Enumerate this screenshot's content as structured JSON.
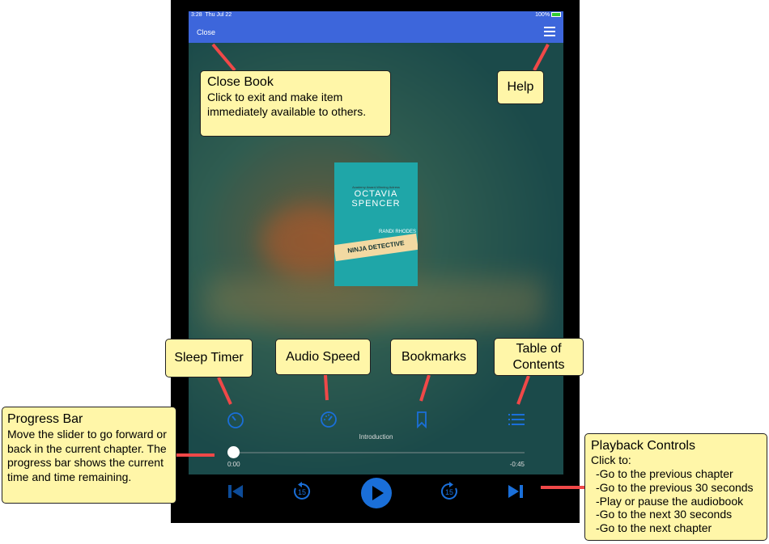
{
  "status": {
    "time": "3:28",
    "date": "Thu Jul 22",
    "battery": "100%"
  },
  "nav": {
    "close": "Close",
    "menu_icon": "hamburger-menu-icon"
  },
  "book": {
    "cover_tagline": "Academy Award-Winning Actress",
    "cover_author": "OCTAVIA SPENCER",
    "cover_series": "RANDI RHODES",
    "cover_title": "NINJA DETECTIVE"
  },
  "player": {
    "chapter": "Introduction",
    "elapsed": "0:00",
    "remaining": "-0:45",
    "progress": 0,
    "skip_seconds": "15",
    "accent": "#1a6fd9"
  },
  "callouts": {
    "close": {
      "title": "Close Book",
      "text": "Click to exit and make item immediately available to others."
    },
    "help": {
      "title": "Help"
    },
    "sleep": {
      "title": "Sleep Timer"
    },
    "speed": {
      "title": "Audio Speed"
    },
    "bookmarks": {
      "title": "Bookmarks"
    },
    "toc": {
      "title": "Table of Contents"
    },
    "progress": {
      "title": "Progress Bar",
      "text": "Move the slider to go forward or back in the current chapter. The progress bar shows the current time and time remaining."
    },
    "playback": {
      "title": "Playback Controls",
      "intro": "Click to:",
      "items": [
        "-Go to the previous chapter",
        "-Go to the previous 30 seconds",
        "-Play or pause the audiobook",
        "-Go to the next 30 seconds",
        "-Go to the next chapter"
      ]
    }
  }
}
